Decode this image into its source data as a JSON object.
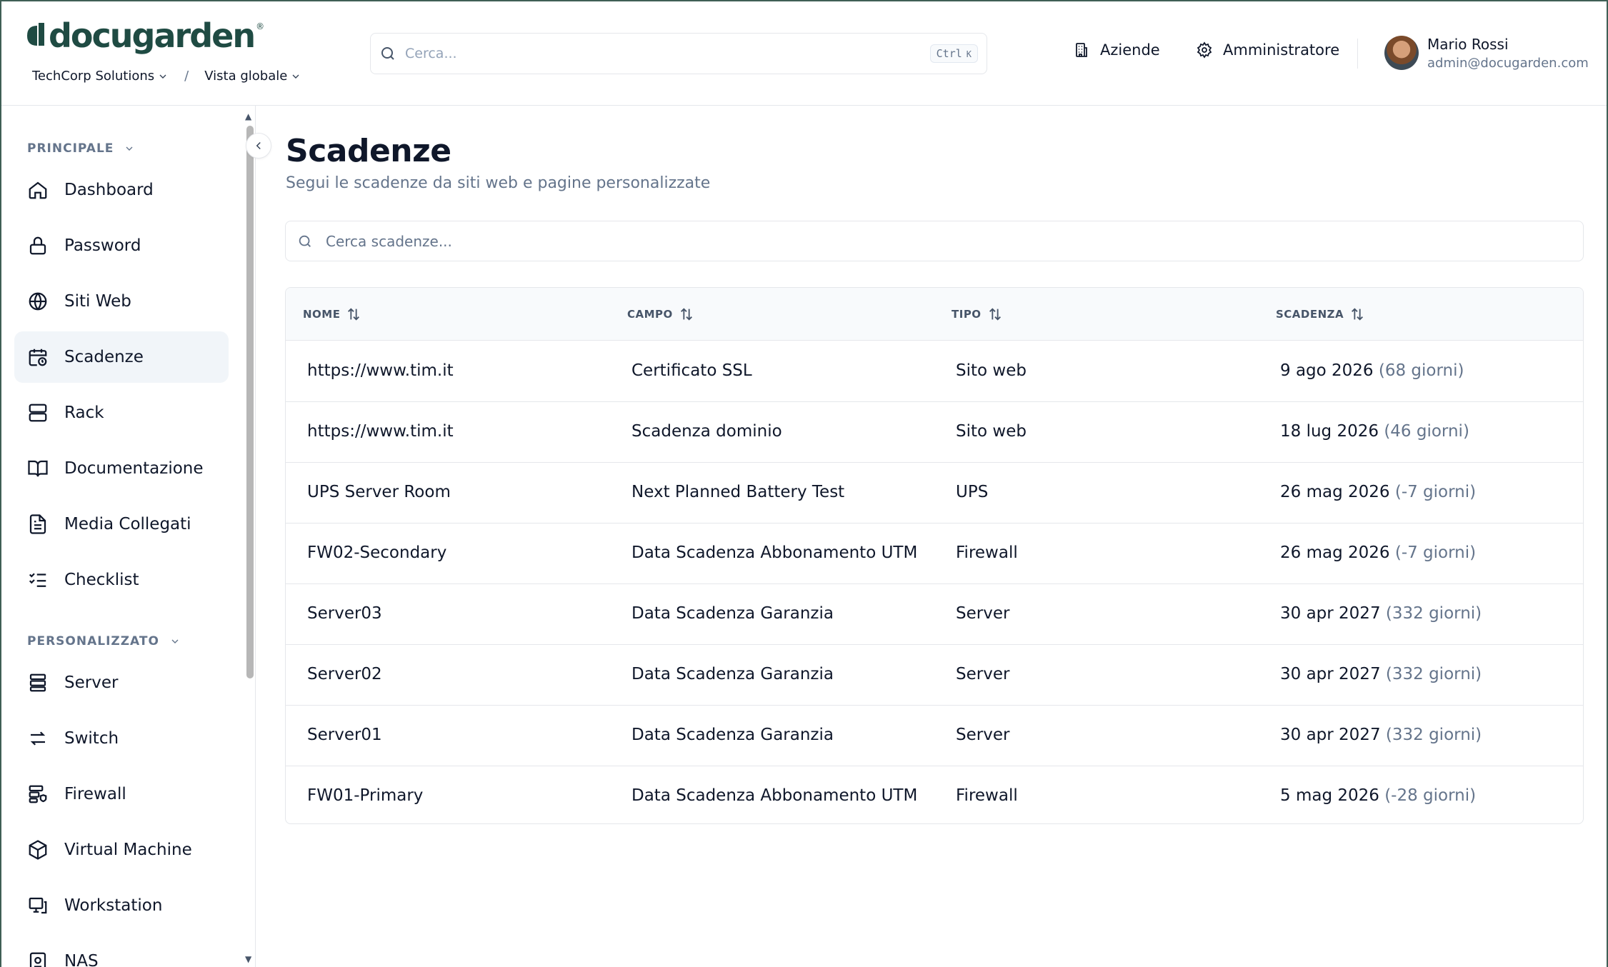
{
  "header": {
    "logo_text": "docugarden",
    "logo_reg": "®",
    "breadcrumb": [
      "TechCorp Solutions",
      "Vista globale"
    ],
    "breadcrumb_sep": "/",
    "search_placeholder": "Cerca...",
    "shortcut": {
      "key1": "Ctrl",
      "key2": "K"
    },
    "companies_label": "Aziende",
    "admin_label": "Amministratore",
    "user": {
      "name": "Mario Rossi",
      "email": "admin@docugarden.com"
    }
  },
  "sidebar": {
    "sections": [
      {
        "title": "PRINCIPALE",
        "items": [
          {
            "label": "Dashboard",
            "icon": "home-icon"
          },
          {
            "label": "Password",
            "icon": "lock-icon"
          },
          {
            "label": "Siti Web",
            "icon": "globe-icon"
          },
          {
            "label": "Scadenze",
            "icon": "calendar-clock-icon",
            "active": true
          },
          {
            "label": "Rack",
            "icon": "server-rack-icon"
          },
          {
            "label": "Documentazione",
            "icon": "book-icon"
          },
          {
            "label": "Media Collegati",
            "icon": "file-text-icon"
          },
          {
            "label": "Checklist",
            "icon": "list-checks-icon"
          }
        ]
      },
      {
        "title": "PERSONALIZZATO",
        "items": [
          {
            "label": "Server",
            "icon": "server-icon"
          },
          {
            "label": "Switch",
            "icon": "arrows-swap-icon"
          },
          {
            "label": "Firewall",
            "icon": "server-shield-icon"
          },
          {
            "label": "Virtual Machine",
            "icon": "box-icon"
          },
          {
            "label": "Workstation",
            "icon": "monitor-icon"
          },
          {
            "label": "NAS",
            "icon": "hard-drive-icon"
          }
        ]
      }
    ]
  },
  "main": {
    "title": "Scadenze",
    "subtitle": "Segui le scadenze da siti web e pagine personalizzate",
    "filter_placeholder": "Cerca scadenze...",
    "columns": [
      "NOME",
      "CAMPO",
      "TIPO",
      "SCADENZA"
    ],
    "rows": [
      {
        "nome": "https://www.tim.it",
        "campo": "Certificato SSL",
        "tipo": "Sito web",
        "data": "9 ago 2026",
        "giorni": "(68 giorni)"
      },
      {
        "nome": "https://www.tim.it",
        "campo": "Scadenza dominio",
        "tipo": "Sito web",
        "data": "18 lug 2026",
        "giorni": "(46 giorni)"
      },
      {
        "nome": "UPS Server Room",
        "campo": "Next Planned Battery Test",
        "tipo": "UPS",
        "data": "26 mag 2026",
        "giorni": "(-7 giorni)"
      },
      {
        "nome": "FW02-Secondary",
        "campo": "Data Scadenza Abbonamento UTM",
        "tipo": "Firewall",
        "data": "26 mag 2026",
        "giorni": "(-7 giorni)"
      },
      {
        "nome": "Server03",
        "campo": "Data Scadenza Garanzia",
        "tipo": "Server",
        "data": "30 apr 2027",
        "giorni": "(332 giorni)"
      },
      {
        "nome": "Server02",
        "campo": "Data Scadenza Garanzia",
        "tipo": "Server",
        "data": "30 apr 2027",
        "giorni": "(332 giorni)"
      },
      {
        "nome": "Server01",
        "campo": "Data Scadenza Garanzia",
        "tipo": "Server",
        "data": "30 apr 2027",
        "giorni": "(332 giorni)"
      },
      {
        "nome": "FW01-Primary",
        "campo": "Data Scadenza Abbonamento UTM",
        "tipo": "Firewall",
        "data": "5 mag 2026",
        "giorni": "(-28 giorni)"
      }
    ]
  },
  "colors": {
    "brand": "#1f4b43",
    "text": "#0f172a",
    "muted": "#64748b",
    "border": "#e5e7eb",
    "active_bg": "#f1f5f9"
  }
}
